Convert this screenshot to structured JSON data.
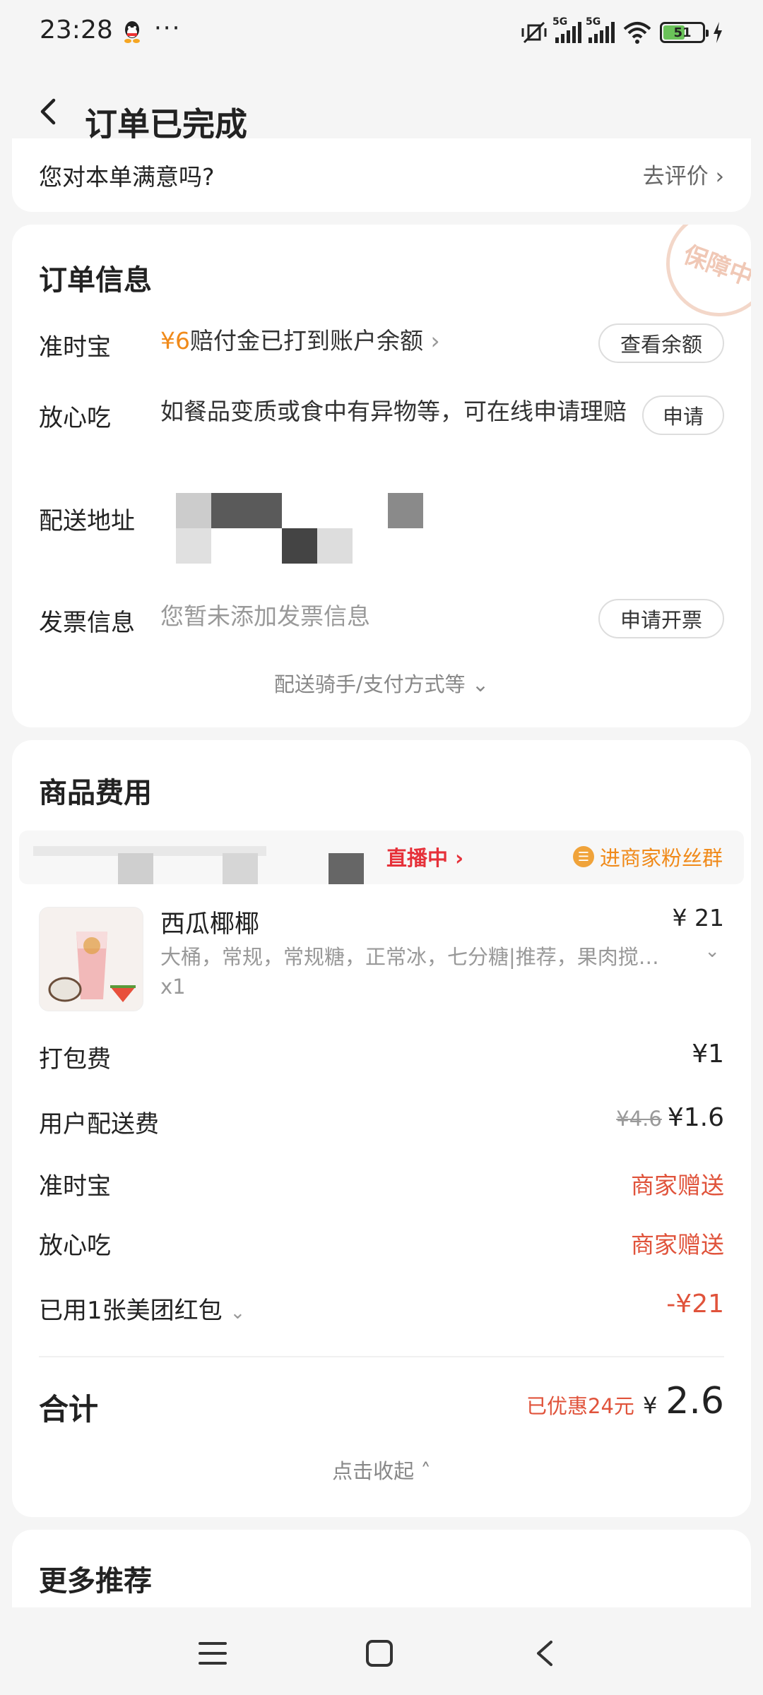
{
  "status_bar": {
    "time": "23:28",
    "dots": "···",
    "net1": "5G",
    "net2": "5G",
    "battery": "51"
  },
  "header": {
    "title": "订单已完成"
  },
  "rating": {
    "question": "您对本单满意吗?",
    "action": "去评价"
  },
  "order_info": {
    "title": "订单信息",
    "stamp": "保障中",
    "ontime": {
      "label": "准时宝",
      "amount": "¥6",
      "text": "赔付金已打到账户余额",
      "button": "查看余额"
    },
    "safe": {
      "label": "放心吃",
      "text": "如餐品变质或食中有异物等，可在线申请理赔",
      "button": "申请"
    },
    "address": {
      "label": "配送地址"
    },
    "invoice": {
      "label": "发票信息",
      "text": "您暂未添加发票信息",
      "button": "申请开票"
    },
    "more": "配送骑手/支付方式等"
  },
  "fees": {
    "title": "商品费用",
    "shop": {
      "live": "直播中",
      "fans": "进商家粉丝群"
    },
    "item": {
      "name": "西瓜椰椰",
      "price": "¥ 21",
      "spec": "大桶，常规，常规糖，正常冰，七分糖|推荐，果肉搅…",
      "qty": "x1"
    },
    "packing": {
      "label": "打包费",
      "value": "¥1"
    },
    "delivery": {
      "label": "用户配送费",
      "original": "¥4.6",
      "value": "¥1.6"
    },
    "ontime": {
      "label": "准时宝",
      "value": "商家赠送"
    },
    "safe": {
      "label": "放心吃",
      "value": "商家赠送"
    },
    "redpacket": {
      "label": "已用1张美团红包",
      "value": "-¥21"
    },
    "total": {
      "label": "合计",
      "discount": "已优惠24元",
      "symbol": "¥",
      "amount": "2.6"
    },
    "collapse": "点击收起"
  },
  "more_recs": {
    "title": "更多推荐"
  },
  "colors": {
    "accent_orange": "#f08a1a",
    "red": "#e0533b",
    "live_red": "#e6313a"
  }
}
